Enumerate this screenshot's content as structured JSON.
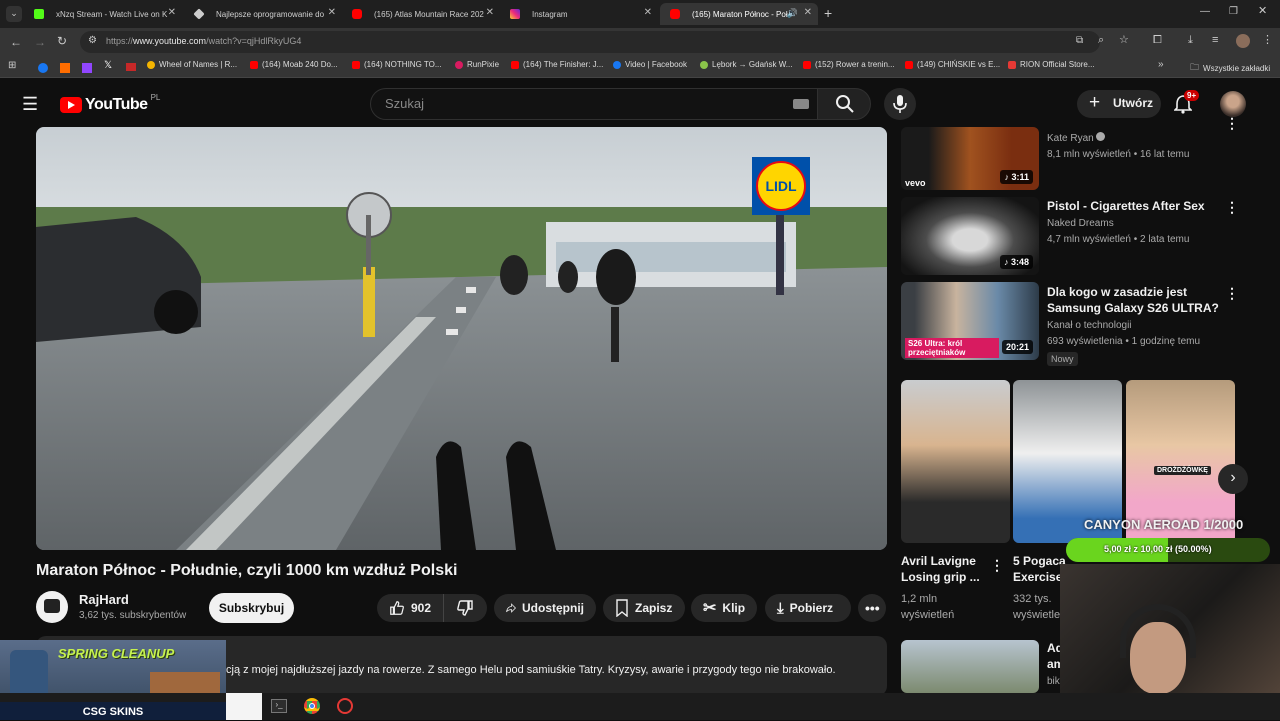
{
  "browser": {
    "tabs": [
      {
        "label": "xNzq Stream - Watch Live on K",
        "color": "#53fc18"
      },
      {
        "label": "Najlepsze oprogramowanie do",
        "color": "#cccccc"
      },
      {
        "label": "(165) Atlas Mountain Race 202",
        "color": "#ff0000"
      },
      {
        "label": "Instagram",
        "color": "#d6249f"
      },
      {
        "label": "(165) Maraton Północ - Poł",
        "color": "#ff0000"
      }
    ],
    "url_prefix": "https://",
    "url_host": "www.youtube.com",
    "url_path": "/watch?v=qjHdlRkyUG4",
    "bookmarks": [
      {
        "label": "Wheel of Names | R...",
        "color": "#f4b400"
      },
      {
        "label": "(164) Moab 240 Do...",
        "color": "#ff0000"
      },
      {
        "label": "(164) NOTHING TO...",
        "color": "#ff0000"
      },
      {
        "label": "RunPixie",
        "color": "#d81b60"
      },
      {
        "label": "(164) The Finisher: J...",
        "color": "#ff0000"
      },
      {
        "label": "Video | Facebook",
        "color": "#1877f2"
      },
      {
        "label": "Lębork → Gdańsk W...",
        "color": "#8bc34a"
      },
      {
        "label": "(152) Rower a trenin...",
        "color": "#ff0000"
      },
      {
        "label": "(149) CHIŃSKIE vs E...",
        "color": "#ff0000"
      },
      {
        "label": "RION Official Store...",
        "color": "#e53935"
      }
    ],
    "all_bookmarks": "Wszystkie zakładki"
  },
  "youtube": {
    "logo_text": "YouTube",
    "logo_region": "PL",
    "search_placeholder": "Szukaj",
    "create_label": "Utwórz",
    "notif_badge": "9+"
  },
  "video": {
    "title": "Maraton Północ - Południe, czyli 1000 km wzdłuż Polski",
    "channel": "RajHard",
    "subscribers": "3,62 tys. subskrybentów",
    "subscribe_label": "Subskrybuj",
    "likes": "902",
    "share_label": "Udostępnij",
    "save_label": "Zapisz",
    "clip_label": "Klip",
    "download_label": "Pobierz",
    "description": "cją z mojej najdłuższej jazdy na rowerze. Z samego Helu pod samiuśkie Tatry. Kryzysy, awarie i przygody tego nie brakowało."
  },
  "sidebar": {
    "items": [
      {
        "title": "",
        "channel": "Kate Ryan",
        "meta": "8,1 mln wyświetleń • 16 lat temu",
        "duration": "3:11",
        "thumb_label": "vevo"
      },
      {
        "title": "Pistol - Cigarettes After Sex",
        "channel": "Naked Dreams",
        "meta": "4,7 mln wyświetleń • 2 lata temu",
        "duration": "3:48"
      },
      {
        "title_line1": "Dla kogo w zasadzie jest",
        "title_line2": "Samsung Galaxy S26 ULTRA?",
        "channel": "Kanał o technologii",
        "meta": "693 wyświetlenia • 1 godzinę temu",
        "duration": "20:21",
        "badge": "Nowy",
        "thumb_label": "S26 Ultra: król przeciętniaków"
      }
    ],
    "shorts": [
      {
        "title_line1": "Avril Lavigne",
        "title_line2": "Losing grip ...",
        "meta_line1": "1,2 mln",
        "meta_line2": "wyświetleń"
      },
      {
        "title_line1": "5 Pogaca",
        "title_line2": "Exercise",
        "meta_line1": "332 tys.",
        "meta_line2": "wyświetleń"
      }
    ],
    "last_item": {
      "title": "Ad",
      "title2": "am",
      "meta": "bik"
    }
  },
  "overlays": {
    "canyon_title": "CANYON AEROAD 1/2000",
    "canyon_progress": "5,00 zł z 10,00 zł (50.00%)",
    "canyon_progress_value": 0.5,
    "spring_cleanup": "SPRING CLEANUP",
    "csg_skins": "CSG SKINS",
    "shorts_thumb_label": "DROŻDŻÓWKĘ"
  }
}
